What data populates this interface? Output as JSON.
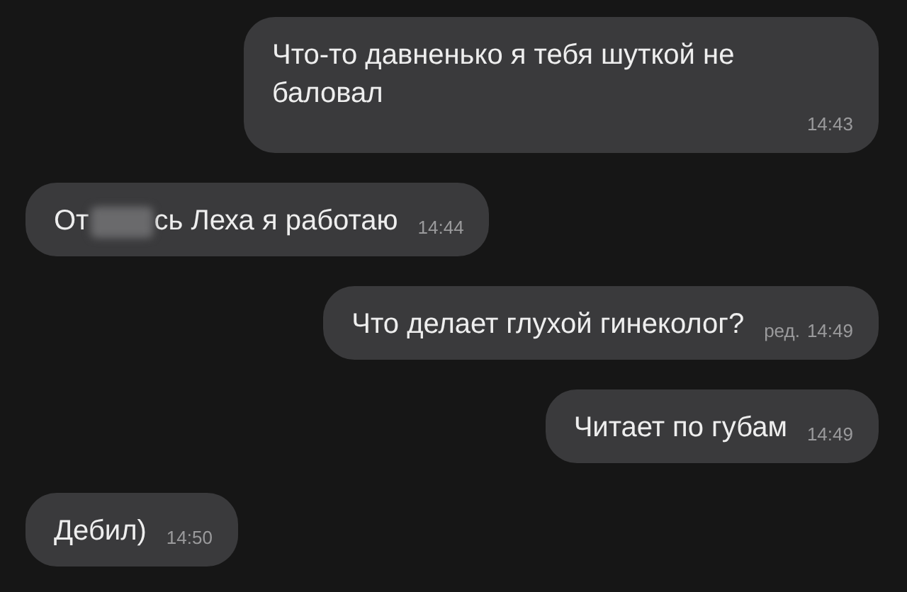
{
  "messages": [
    {
      "kind": "outgoing",
      "parts": [
        "Что-то давненько я тебя шуткой не баловал"
      ],
      "time": "14:43"
    },
    {
      "kind": "incoming",
      "parts": [
        "От",
        "сь Леха я работаю"
      ],
      "censored": true,
      "time": "14:44"
    },
    {
      "kind": "outgoing",
      "parts": [
        "Что делает глухой гинеколог?"
      ],
      "edited": "ред.",
      "time": "14:49"
    },
    {
      "kind": "outgoing",
      "parts": [
        "Читает по губам"
      ],
      "time": "14:49"
    },
    {
      "kind": "incoming",
      "parts": [
        "Дебил)"
      ],
      "time": "14:50"
    }
  ]
}
